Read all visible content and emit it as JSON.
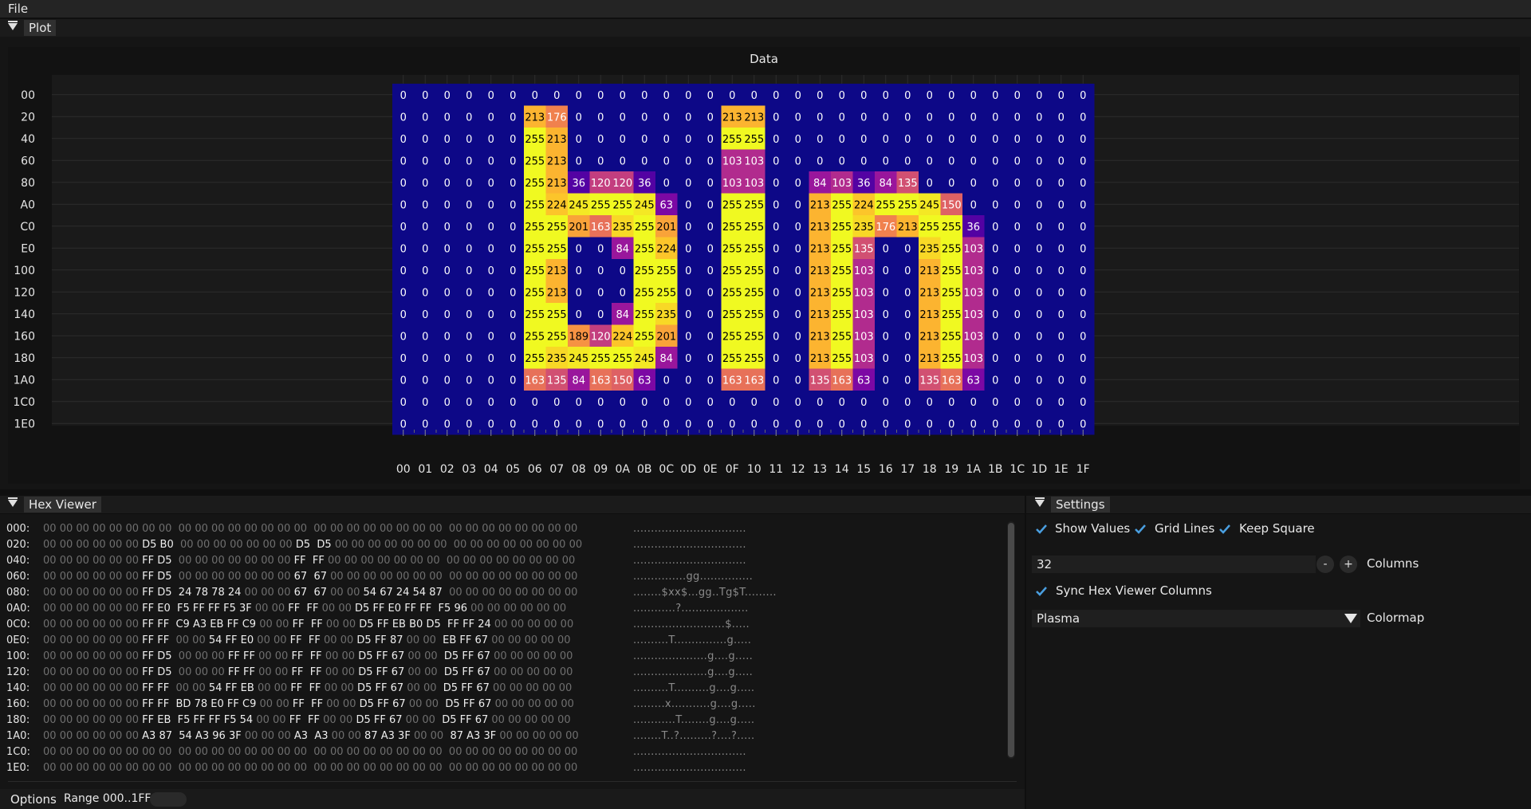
{
  "menu": {
    "file": "File"
  },
  "plot_panel": {
    "tab": "Plot"
  },
  "chart_data": {
    "type": "heatmap",
    "title": "Data",
    "colormap": "Plasma",
    "x_labels": [
      "00",
      "01",
      "02",
      "03",
      "04",
      "05",
      "06",
      "07",
      "08",
      "09",
      "0A",
      "0B",
      "0C",
      "0D",
      "0E",
      "0F",
      "10",
      "11",
      "12",
      "13",
      "14",
      "15",
      "16",
      "17",
      "18",
      "19",
      "1A",
      "1B",
      "1C",
      "1D",
      "1E",
      "1F"
    ],
    "y_labels": [
      "00",
      "20",
      "40",
      "60",
      "80",
      "A0",
      "C0",
      "E0",
      "100",
      "120",
      "140",
      "160",
      "180",
      "1A0",
      "1C0",
      "1E0"
    ],
    "values": [
      [
        0,
        0,
        0,
        0,
        0,
        0,
        0,
        0,
        0,
        0,
        0,
        0,
        0,
        0,
        0,
        0,
        0,
        0,
        0,
        0,
        0,
        0,
        0,
        0,
        0,
        0,
        0,
        0,
        0,
        0,
        0,
        0
      ],
      [
        0,
        0,
        0,
        0,
        0,
        0,
        213,
        176,
        0,
        0,
        0,
        0,
        0,
        0,
        0,
        213,
        213,
        0,
        0,
        0,
        0,
        0,
        0,
        0,
        0,
        0,
        0,
        0,
        0,
        0,
        0,
        0
      ],
      [
        0,
        0,
        0,
        0,
        0,
        0,
        255,
        213,
        0,
        0,
        0,
        0,
        0,
        0,
        0,
        255,
        255,
        0,
        0,
        0,
        0,
        0,
        0,
        0,
        0,
        0,
        0,
        0,
        0,
        0,
        0,
        0
      ],
      [
        0,
        0,
        0,
        0,
        0,
        0,
        255,
        213,
        0,
        0,
        0,
        0,
        0,
        0,
        0,
        103,
        103,
        0,
        0,
        0,
        0,
        0,
        0,
        0,
        0,
        0,
        0,
        0,
        0,
        0,
        0,
        0
      ],
      [
        0,
        0,
        0,
        0,
        0,
        0,
        255,
        213,
        36,
        120,
        120,
        36,
        0,
        0,
        0,
        103,
        103,
        0,
        0,
        84,
        103,
        36,
        84,
        135,
        0,
        0,
        0,
        0,
        0,
        0,
        0,
        0
      ],
      [
        0,
        0,
        0,
        0,
        0,
        0,
        255,
        224,
        245,
        255,
        255,
        245,
        63,
        0,
        0,
        255,
        255,
        0,
        0,
        213,
        255,
        224,
        255,
        255,
        245,
        150,
        0,
        0,
        0,
        0,
        0,
        0
      ],
      [
        0,
        0,
        0,
        0,
        0,
        0,
        255,
        255,
        201,
        163,
        235,
        255,
        201,
        0,
        0,
        255,
        255,
        0,
        0,
        213,
        255,
        235,
        176,
        213,
        255,
        255,
        36,
        0,
        0,
        0,
        0,
        0
      ],
      [
        0,
        0,
        0,
        0,
        0,
        0,
        255,
        255,
        0,
        0,
        84,
        255,
        224,
        0,
        0,
        255,
        255,
        0,
        0,
        213,
        255,
        135,
        0,
        0,
        235,
        255,
        103,
        0,
        0,
        0,
        0,
        0
      ],
      [
        0,
        0,
        0,
        0,
        0,
        0,
        255,
        213,
        0,
        0,
        0,
        255,
        255,
        0,
        0,
        255,
        255,
        0,
        0,
        213,
        255,
        103,
        0,
        0,
        213,
        255,
        103,
        0,
        0,
        0,
        0,
        0
      ],
      [
        0,
        0,
        0,
        0,
        0,
        0,
        255,
        213,
        0,
        0,
        0,
        255,
        255,
        0,
        0,
        255,
        255,
        0,
        0,
        213,
        255,
        103,
        0,
        0,
        213,
        255,
        103,
        0,
        0,
        0,
        0,
        0
      ],
      [
        0,
        0,
        0,
        0,
        0,
        0,
        255,
        255,
        0,
        0,
        84,
        255,
        235,
        0,
        0,
        255,
        255,
        0,
        0,
        213,
        255,
        103,
        0,
        0,
        213,
        255,
        103,
        0,
        0,
        0,
        0,
        0
      ],
      [
        0,
        0,
        0,
        0,
        0,
        0,
        255,
        255,
        189,
        120,
        224,
        255,
        201,
        0,
        0,
        255,
        255,
        0,
        0,
        213,
        255,
        103,
        0,
        0,
        213,
        255,
        103,
        0,
        0,
        0,
        0,
        0
      ],
      [
        0,
        0,
        0,
        0,
        0,
        0,
        255,
        235,
        245,
        255,
        255,
        245,
        84,
        0,
        0,
        255,
        255,
        0,
        0,
        213,
        255,
        103,
        0,
        0,
        213,
        255,
        103,
        0,
        0,
        0,
        0,
        0
      ],
      [
        0,
        0,
        0,
        0,
        0,
        0,
        163,
        135,
        84,
        163,
        150,
        63,
        0,
        0,
        0,
        163,
        163,
        0,
        0,
        135,
        163,
        63,
        0,
        0,
        135,
        163,
        63,
        0,
        0,
        0,
        0,
        0
      ],
      [
        0,
        0,
        0,
        0,
        0,
        0,
        0,
        0,
        0,
        0,
        0,
        0,
        0,
        0,
        0,
        0,
        0,
        0,
        0,
        0,
        0,
        0,
        0,
        0,
        0,
        0,
        0,
        0,
        0,
        0,
        0,
        0
      ],
      [
        0,
        0,
        0,
        0,
        0,
        0,
        0,
        0,
        0,
        0,
        0,
        0,
        0,
        0,
        0,
        0,
        0,
        0,
        0,
        0,
        0,
        0,
        0,
        0,
        0,
        0,
        0,
        0,
        0,
        0,
        0,
        0
      ]
    ],
    "show_values": true,
    "grid_lines": true
  },
  "hex_panel": {
    "tab": "Hex Viewer",
    "lines": [
      {
        "addr": "000:",
        "bytes": "00 00 00 00 00 00 00 00  00 00 00 00 00 00 00 00  00 00 00 00 00 00 00 00  00 00 00 00 00 00 00 00",
        "ascii": "................................"
      },
      {
        "addr": "020:",
        "bytes": "00 00 00 00 00 00 D5 B0  00 00 00 00 00 00 00 D5  D5 00 00 00 00 00 00 00  00 00 00 00 00 00 00 00",
        "ascii": "................................"
      },
      {
        "addr": "040:",
        "bytes": "00 00 00 00 00 00 FF D5  00 00 00 00 00 00 00 FF  FF 00 00 00 00 00 00 00  00 00 00 00 00 00 00 00",
        "ascii": "................................"
      },
      {
        "addr": "060:",
        "bytes": "00 00 00 00 00 00 FF D5  00 00 00 00 00 00 00 67  67 00 00 00 00 00 00 00  00 00 00 00 00 00 00 00",
        "ascii": "...............gg..............."
      },
      {
        "addr": "080:",
        "bytes": "00 00 00 00 00 00 FF D5  24 78 78 24 00 00 00 67  67 00 00 54 67 24 54 87  00 00 00 00 00 00 00 00",
        "ascii": "........$xx$...gg..Tg$T........."
      },
      {
        "addr": "0A0:",
        "bytes": "00 00 00 00 00 00 FF E0  F5 FF FF F5 3F 00 00 FF  FF 00 00 D5 FF E0 FF FF  F5 96 00 00 00 00 00 00",
        "ascii": "............?..................."
      },
      {
        "addr": "0C0:",
        "bytes": "00 00 00 00 00 00 FF FF  C9 A3 EB FF C9 00 00 FF  FF 00 00 D5 FF EB B0 D5  FF FF 24 00 00 00 00 00",
        "ascii": "..........................$....."
      },
      {
        "addr": "0E0:",
        "bytes": "00 00 00 00 00 00 FF FF  00 00 54 FF E0 00 00 FF  FF 00 00 D5 FF 87 00 00  EB FF 67 00 00 00 00 00",
        "ascii": "..........T...............g....."
      },
      {
        "addr": "100:",
        "bytes": "00 00 00 00 00 00 FF D5  00 00 00 FF FF 00 00 FF  FF 00 00 D5 FF 67 00 00  D5 FF 67 00 00 00 00 00",
        "ascii": ".....................g....g....."
      },
      {
        "addr": "120:",
        "bytes": "00 00 00 00 00 00 FF D5  00 00 00 FF FF 00 00 FF  FF 00 00 D5 FF 67 00 00  D5 FF 67 00 00 00 00 00",
        "ascii": ".....................g....g....."
      },
      {
        "addr": "140:",
        "bytes": "00 00 00 00 00 00 FF FF  00 00 54 FF EB 00 00 FF  FF 00 00 D5 FF 67 00 00  D5 FF 67 00 00 00 00 00",
        "ascii": "..........T..........g....g....."
      },
      {
        "addr": "160:",
        "bytes": "00 00 00 00 00 00 FF FF  BD 78 E0 FF C9 00 00 FF  FF 00 00 D5 FF 67 00 00  D5 FF 67 00 00 00 00 00",
        "ascii": ".........x...........g....g....."
      },
      {
        "addr": "180:",
        "bytes": "00 00 00 00 00 00 FF EB  F5 FF FF F5 54 00 00 FF  FF 00 00 D5 FF 67 00 00  D5 FF 67 00 00 00 00 00",
        "ascii": "............T........g....g....."
      },
      {
        "addr": "1A0:",
        "bytes": "00 00 00 00 00 00 A3 87  54 A3 96 3F 00 00 00 A3  A3 00 00 87 A3 3F 00 00  87 A3 3F 00 00 00 00 00",
        "ascii": "........T..?.........?....?....."
      },
      {
        "addr": "1C0:",
        "bytes": "00 00 00 00 00 00 00 00  00 00 00 00 00 00 00 00  00 00 00 00 00 00 00 00  00 00 00 00 00 00 00 00",
        "ascii": "................................"
      },
      {
        "addr": "1E0:",
        "bytes": "00 00 00 00 00 00 00 00  00 00 00 00 00 00 00 00  00 00 00 00 00 00 00 00  00 00 00 00 00 00 00 00",
        "ascii": "................................"
      }
    ],
    "options_label": "Options",
    "range_label": "Range 000..1FF"
  },
  "settings_panel": {
    "tab": "Settings",
    "show_values": "Show Values",
    "grid_lines": "Grid Lines",
    "keep_square": "Keep Square",
    "columns_value": "32",
    "minus": "-",
    "plus": "+",
    "columns_label": "Columns",
    "sync_label": "Sync Hex Viewer Columns",
    "colormap_value": "Plasma",
    "colormap_label": "Colormap"
  },
  "colors": {
    "accent": "#4a9fe0",
    "panel_bg": "#151515",
    "tab_bg": "#303030"
  }
}
